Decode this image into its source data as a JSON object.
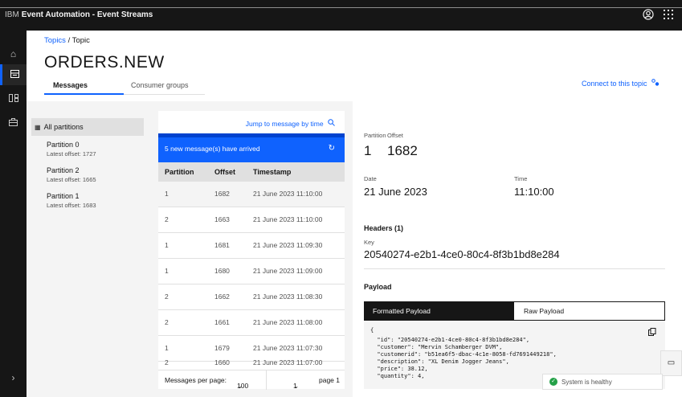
{
  "topbar": {
    "brand_prefix": "IBM",
    "brand_product": "Event Automation - Event Streams",
    "icons": [
      "user-avatar-icon",
      "app-switcher-icon"
    ]
  },
  "leftnav": {
    "icons": [
      "home-icon",
      "topics-icon",
      "schema-icon",
      "toolbox-icon",
      "expand-chevron-icon"
    ]
  },
  "breadcrumb": {
    "parent": "Topics",
    "separator": "/",
    "current": "Topic"
  },
  "page_title": "ORDERS.NEW",
  "tabs": [
    {
      "label": "Messages",
      "selected": true
    },
    {
      "label": "Consumer groups",
      "selected": false
    }
  ],
  "connect_label": "Connect to this topic",
  "partitions": {
    "all_label": "All partitions",
    "items": [
      {
        "name": "Partition 0",
        "latest": "Latest offset: 1727"
      },
      {
        "name": "Partition 2",
        "latest": "Latest offset: 1665"
      },
      {
        "name": "Partition 1",
        "latest": "Latest offset: 1683"
      }
    ]
  },
  "messages": {
    "jump_label": "Jump to message by time",
    "new_notice": "5 new message(s) have arrived",
    "columns": [
      "Partition",
      "Offset",
      "Timestamp"
    ],
    "rows": [
      [
        "1",
        "1682",
        "21 June 2023 11:10:00"
      ],
      [
        "2",
        "1663",
        "21 June 2023 11:10:00"
      ],
      [
        "1",
        "1681",
        "21 June 2023 11:09:30"
      ],
      [
        "1",
        "1680",
        "21 June 2023 11:09:00"
      ],
      [
        "2",
        "1662",
        "21 June 2023 11:08:30"
      ],
      [
        "2",
        "1661",
        "21 June 2023 11:08:00"
      ],
      [
        "1",
        "1679",
        "21 June 2023 11:07:30"
      ],
      [
        "2",
        "1660",
        "21 June 2023 11:07:00"
      ]
    ],
    "pager": {
      "per_page_label": "Messages per page:",
      "per_page_value": "100",
      "page_value": "1",
      "page_label": "page 1"
    }
  },
  "detail": {
    "partition_label": "Partition",
    "offset_label": "Offset",
    "partition_value": "1",
    "offset_value": "1682",
    "date_label": "Date",
    "date_value": "21 June 2023",
    "time_label": "Time",
    "time_value": "11:10:00",
    "headers_label": "Headers (1)",
    "key_label": "Key",
    "key_value": "20540274-e2b1-4ce0-80c4-8f3b1bd8e284",
    "payload_label": "Payload",
    "payload_tabs": [
      "Formatted Payload",
      "Raw Payload"
    ],
    "payload_lines": [
      "{",
      "  \"id\": \"20540274-e2b1-4ce0-80c4-8f3b1bd8e284\",",
      "  \"customer\": \"Mervin Schamberger DVM\",",
      "  \"customerid\": \"b51ea6f5-dbac-4c1e-8058-fd7691449218\",",
      "  \"description\": \"XL Denim Jogger Jeans\",",
      "  \"price\": 38.12,",
      "  \"quantity\": 4,"
    ]
  },
  "status": {
    "health_label": "System is healthy"
  }
}
